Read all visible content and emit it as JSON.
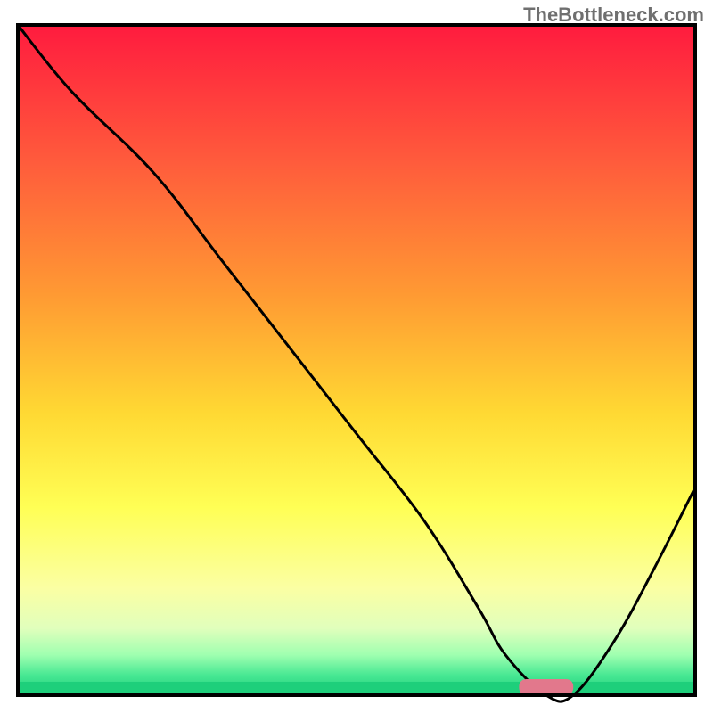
{
  "watermark": "TheBottleneck.com",
  "chart_data": {
    "type": "line",
    "title": "",
    "xlabel": "",
    "ylabel": "",
    "xlim": [
      0,
      100
    ],
    "ylim": [
      0,
      100
    ],
    "grid": false,
    "legend": false,
    "gradient": {
      "stops": [
        {
          "pos": 0.0,
          "color": "#ff1b3e"
        },
        {
          "pos": 0.2,
          "color": "#ff5a3c"
        },
        {
          "pos": 0.4,
          "color": "#ff9933"
        },
        {
          "pos": 0.58,
          "color": "#ffd933"
        },
        {
          "pos": 0.72,
          "color": "#ffff55"
        },
        {
          "pos": 0.84,
          "color": "#fbffa3"
        },
        {
          "pos": 0.9,
          "color": "#e1ffbc"
        },
        {
          "pos": 0.94,
          "color": "#9fffb0"
        },
        {
          "pos": 0.97,
          "color": "#48e893"
        },
        {
          "pos": 1.0,
          "color": "#1ecf7b"
        }
      ]
    },
    "series": [
      {
        "name": "bottleneck-curve",
        "type": "line",
        "x": [
          0,
          8,
          20,
          30,
          40,
          50,
          60,
          68,
          72,
          78,
          82,
          88,
          94,
          100
        ],
        "values": [
          100,
          90,
          78,
          65,
          52,
          39,
          26,
          13,
          6,
          0,
          0,
          8,
          19,
          31
        ]
      }
    ],
    "marker": {
      "name": "optimal-zone",
      "x_center": 78,
      "y": 1.2,
      "width": 8,
      "height": 2.4,
      "color": "#e2788c"
    }
  }
}
